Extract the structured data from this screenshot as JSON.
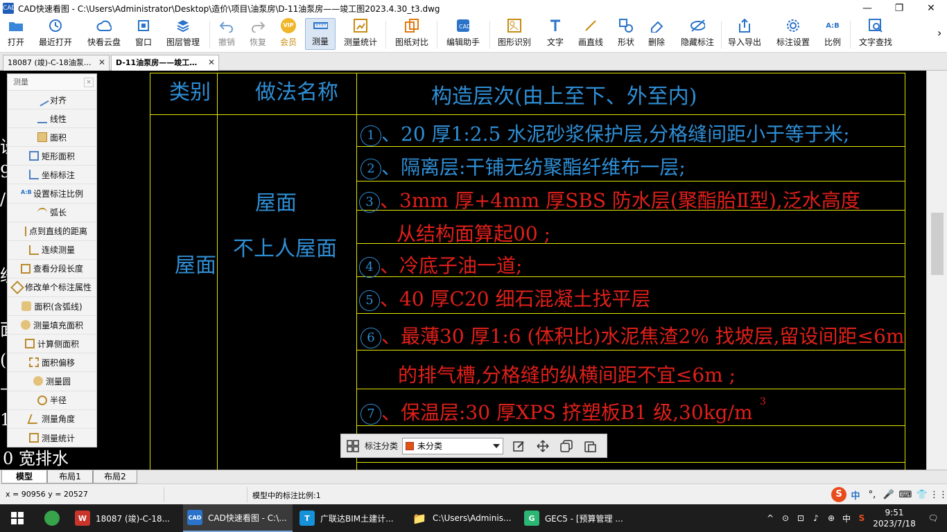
{
  "window": {
    "app_icon": "CAD",
    "title": "CAD快速看图 - C:\\Users\\Administrator\\Desktop\\造价\\项目\\油泵房\\D-11油泵房——竣工图2023.4.30_t3.dwg",
    "min": "—",
    "max": "❐",
    "close": "✕"
  },
  "toolbar": [
    {
      "id": "open",
      "label": "打开",
      "icon": "folder-icon"
    },
    {
      "id": "recent",
      "label": "最近打开",
      "icon": "clock-icon"
    },
    {
      "id": "cloud",
      "label": "快看云盘",
      "icon": "cloud-icon"
    },
    {
      "id": "window",
      "label": "窗口",
      "icon": "window-icon"
    },
    {
      "id": "layer",
      "label": "图层管理",
      "icon": "layers-icon"
    },
    {
      "id": "undo",
      "label": "撤销",
      "icon": "undo-icon"
    },
    {
      "id": "redo",
      "label": "恢复",
      "icon": "redo-icon"
    },
    {
      "id": "vip",
      "label": "会员",
      "icon": "vip-icon",
      "badge": "VIP"
    },
    {
      "id": "measure",
      "label": "测量",
      "icon": "ruler-icon"
    },
    {
      "id": "mstat",
      "label": "测量统计",
      "icon": "measure-stat-icon"
    },
    {
      "id": "compare",
      "label": "图纸对比",
      "icon": "compare-icon"
    },
    {
      "id": "edit",
      "label": "编辑助手",
      "icon": "edit-assistant-icon"
    },
    {
      "id": "recog",
      "label": "图形识别",
      "icon": "shape-recognize-icon"
    },
    {
      "id": "text",
      "label": "文字",
      "icon": "text-icon"
    },
    {
      "id": "line",
      "label": "画直线",
      "icon": "line-icon"
    },
    {
      "id": "shape",
      "label": "形状",
      "icon": "shape-icon"
    },
    {
      "id": "delete",
      "label": "删除",
      "icon": "eraser-icon"
    },
    {
      "id": "hide",
      "label": "隐藏标注",
      "icon": "hide-icon"
    },
    {
      "id": "export",
      "label": "导入导出",
      "icon": "export-icon"
    },
    {
      "id": "setting",
      "label": "标注设置",
      "icon": "gear-icon"
    },
    {
      "id": "ratio",
      "label": "比例",
      "icon": "ratio-icon",
      "badge": "A:B"
    },
    {
      "id": "find",
      "label": "文字查找",
      "icon": "search-text-icon"
    }
  ],
  "toolbar_more": "›",
  "tabs": [
    {
      "label": "18087 (竣)-C-18油泵…",
      "close": "✕"
    },
    {
      "label": "D-11油泵房——竣工…",
      "close": "✕"
    }
  ],
  "measure_panel": {
    "title": "测量",
    "close": "×",
    "items": [
      "对齐",
      "线性",
      "面积",
      "矩形面积",
      "坐标标注",
      "设置标注比例",
      "弧长",
      "点到直线的距离",
      "连续测量",
      "查看分段长度",
      "修改单个标注属性",
      "面积(含弧线)",
      "测量填充面积",
      "计算侧面积",
      "面积偏移",
      "测量圆",
      "半径",
      "测量角度",
      "测量统计"
    ]
  },
  "drawing": {
    "headers": [
      "类别",
      "做法名称",
      "构造层次(由上至下、外至内)"
    ],
    "category": "屋面",
    "method_line1": "屋面",
    "method_line2": "不上人屋面",
    "rows": [
      {
        "num": "1",
        "text": "、20  厚1:2.5   水泥砂浆保护层,分格缝间距小于等于米;",
        "color": "cyan"
      },
      {
        "num": "2",
        "text": "、隔离层:干铺无纺聚酯纤维布一层;",
        "color": "cyan"
      },
      {
        "num": "3",
        "text": "、3mm  厚+4mm   厚SBS 防水层(聚酯胎Ⅱ型),泛水高度",
        "color": "red"
      },
      {
        "num": "",
        "text": "从结构面算起00  ;",
        "color": "red"
      },
      {
        "num": "4",
        "text": "、冷底子油一道;",
        "color": "red"
      },
      {
        "num": "5",
        "text": "、40  厚C20  细石混凝土找平层",
        "color": "red"
      },
      {
        "num": "6",
        "text": "、最薄30  厚1:6 (体积比)水泥焦渣2% 找坡层,留设间距≤6m",
        "color": "red"
      },
      {
        "num": "",
        "text": "的排气槽,分格缝的纵横间距不宜≤6m  ;",
        "color": "red"
      },
      {
        "num": "7",
        "text": "、保温层:30  厚XPS  挤塑板B1 级,30kg/m",
        "color": "red"
      }
    ],
    "superscript": "3",
    "left_fragments": [
      "设",
      "9",
      "/",
      "绞",
      "面",
      "(",
      "—",
      "1",
      "0  宽排水"
    ]
  },
  "annotation_bar": {
    "label": "标注分类",
    "value": "未分类",
    "swatch_color": "#e0530f"
  },
  "layout_tabs": [
    "模型",
    "布局1",
    "布局2"
  ],
  "status": {
    "coords": "x = 90956  y = 20527",
    "scale": "模型中的标注比例:1"
  },
  "ime": [
    "中",
    "°,",
    "🎤",
    "⌨",
    "👕",
    "⋮⋮"
  ],
  "taskbar": {
    "items": [
      {
        "label": "18087 (竣)-C-18...",
        "icon": "W",
        "color": "#c9342b"
      },
      {
        "label": "CAD快速看图 - C:\\...",
        "icon": "CAD",
        "color": "#2a73c9"
      },
      {
        "label": "广联达BIM土建计...",
        "icon": "T",
        "color": "#1592d8"
      },
      {
        "label": "C:\\Users\\Adminis...",
        "icon": "📁",
        "color": "#e8b73a"
      },
      {
        "label": "GEC5 - [预算管理 ...",
        "icon": "G",
        "color": "#2bb673"
      }
    ],
    "tray": [
      "^",
      "⊙",
      "⊡",
      "♪",
      "⊕",
      "中",
      "S"
    ],
    "time": "9:51",
    "date": "2023/7/18",
    "notify": "🗨"
  }
}
